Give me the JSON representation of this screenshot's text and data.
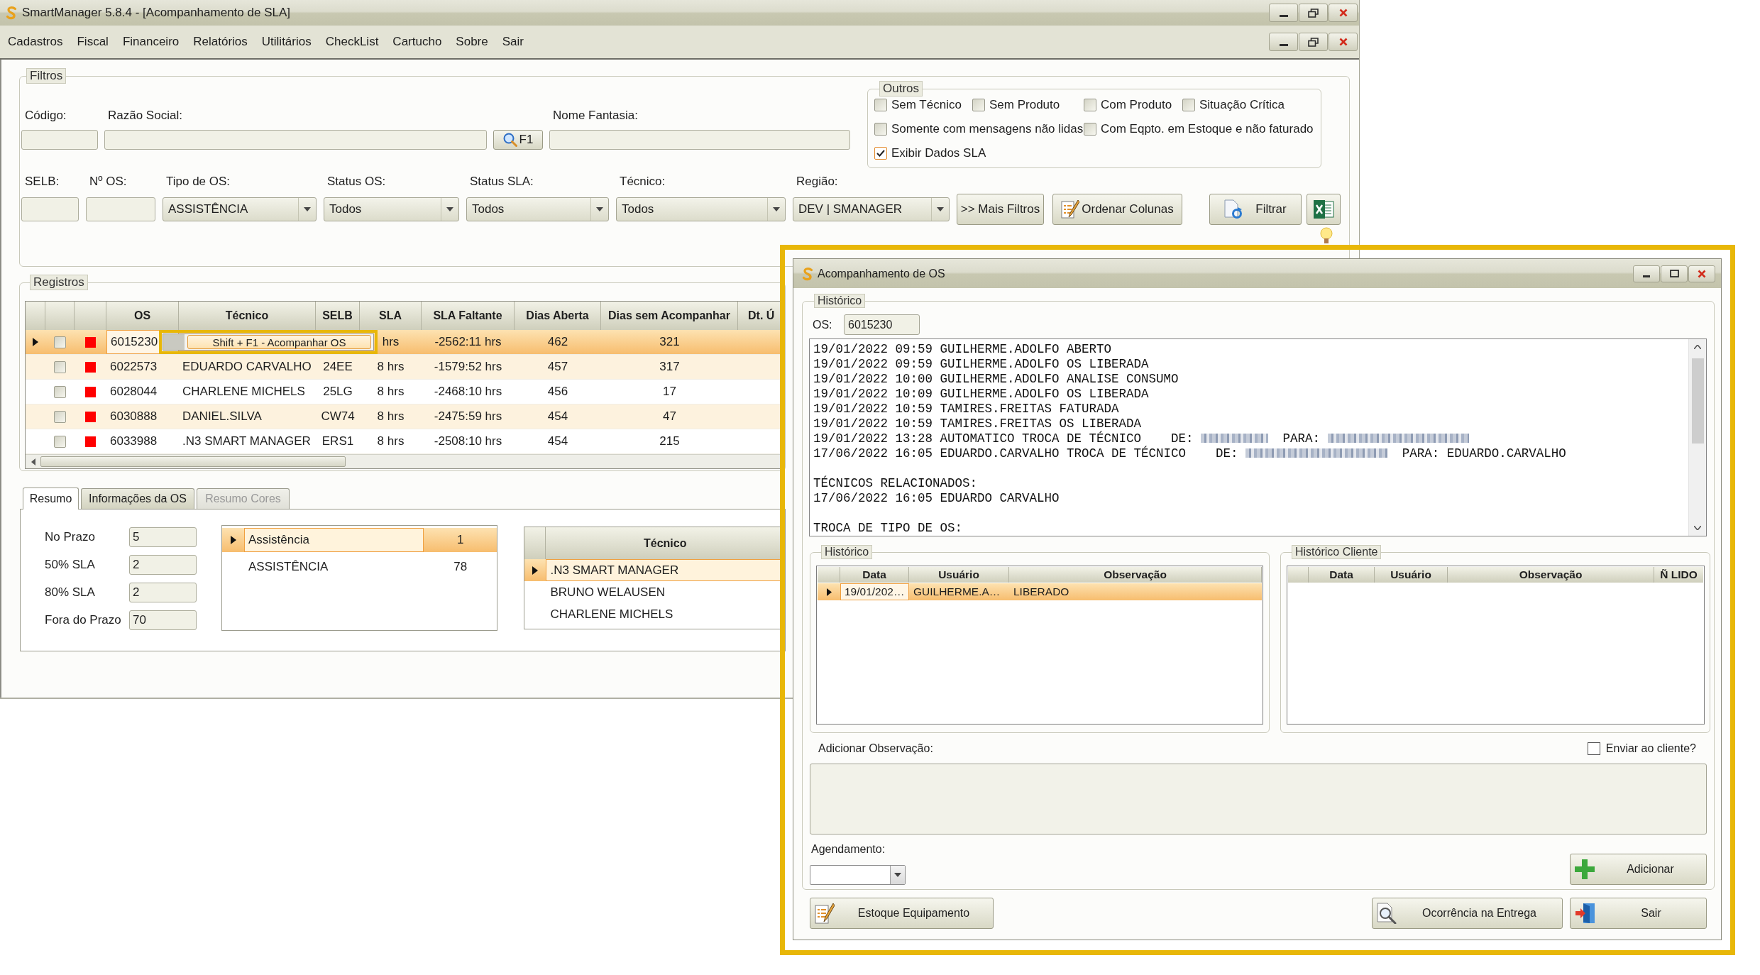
{
  "window": {
    "title": "SmartManager 5.8.4 - [Acompanhamento de SLA]"
  },
  "menu": [
    "Cadastros",
    "Fiscal",
    "Financeiro",
    "Relatórios",
    "Utilitários",
    "CheckList",
    "Cartucho",
    "Sobre",
    "Sair"
  ],
  "filters": {
    "title": "Filtros",
    "row1": [
      {
        "kind": "input",
        "label": "Código:"
      },
      {
        "kind": "input",
        "label": "Razão Social:"
      },
      {
        "kind": "search",
        "text": "F1"
      },
      {
        "kind": "input",
        "label": "Nome Fantasia:"
      }
    ],
    "others": {
      "title": "Outros",
      "options": [
        {
          "label": "Sem Técnico",
          "checked": false
        },
        {
          "label": "Sem Produto",
          "checked": false
        },
        {
          "label": "Com Produto",
          "checked": false
        },
        {
          "label": "Situação Crítica",
          "checked": false
        },
        {
          "label": "Somente com mensagens não lidas",
          "checked": false
        },
        {
          "label": "Com Eqpto. em Estoque e não faturado",
          "checked": false
        },
        {
          "label": "Exibir Dados SLA",
          "checked": true
        }
      ]
    },
    "row2": [
      {
        "kind": "input",
        "label": "SELB:"
      },
      {
        "kind": "input",
        "label": "Nº OS:"
      },
      {
        "kind": "combo",
        "label": "Tipo de OS:",
        "value": "ASSISTÊNCIA"
      },
      {
        "kind": "combo",
        "label": "Status OS:",
        "value": "Todos"
      },
      {
        "kind": "combo",
        "label": "Status SLA:",
        "value": "Todos"
      },
      {
        "kind": "combo",
        "label": "Técnico:",
        "value": "Todos"
      },
      {
        "kind": "combo",
        "label": "Região:",
        "value": "DEV | SMANAGER"
      }
    ],
    "actions": [
      {
        "kind": "more",
        "label": ">> Mais Filtros"
      },
      {
        "kind": "order",
        "label": "Ordenar Colunas"
      },
      {
        "kind": "filter",
        "label": "Filtrar"
      },
      {
        "kind": "export"
      }
    ]
  },
  "records": {
    "title": "Registros",
    "columns": [
      "OS",
      "Técnico",
      "SELB",
      "SLA",
      "SLA Faltante",
      "Dias Aberta",
      "Dias sem Acompanhar",
      "Dt. Ú"
    ],
    "rows": [
      {
        "selected": true,
        "checked": false,
        "color": "#ff0000",
        "os": "6015230",
        "sla": "hrs",
        "sla_remaining": "-2562:11 hrs",
        "days_open": "462",
        "days_without_follow_up": "321"
      },
      {
        "selected": false,
        "checked": false,
        "color": "#ff0000",
        "os": "6022573",
        "technician": "EDUARDO CARVALHO",
        "selb": "24EE",
        "sla": "8 hrs",
        "sla_remaining": "-1579:52 hrs",
        "days_open": "457",
        "days_without_follow_up": "317"
      },
      {
        "selected": false,
        "checked": false,
        "color": "#ff0000",
        "os": "6028044",
        "technician": "CHARLENE MICHELS",
        "selb": "25LG",
        "sla": "8 hrs",
        "sla_remaining": "-2468:10 hrs",
        "days_open": "456",
        "days_without_follow_up": "17"
      },
      {
        "selected": false,
        "checked": false,
        "color": "#ff0000",
        "os": "6030888",
        "technician": "DANIEL.SILVA",
        "selb": "CW74",
        "sla": "8 hrs",
        "sla_remaining": "-2475:59 hrs",
        "days_open": "454",
        "days_without_follow_up": "47"
      },
      {
        "selected": false,
        "checked": false,
        "color": "#ff0000",
        "os": "6033988",
        "technician": ".N3 SMART MANAGER",
        "selb": "ERS1",
        "sla": "8 hrs",
        "sla_remaining": "-2508:10 hrs",
        "days_open": "454",
        "days_without_follow_up": "215"
      }
    ],
    "context_menu": {
      "items": [
        {
          "label": "Shift + F1 - Acompanhar OS",
          "selected": true
        }
      ]
    }
  },
  "summary": {
    "tabs": [
      {
        "label": "Resumo",
        "selected": true,
        "disabled": false
      },
      {
        "label": "Informações da OS",
        "selected": false,
        "disabled": false
      },
      {
        "label": "Resumo Cores",
        "selected": false,
        "disabled": true
      }
    ],
    "counts": [
      {
        "label": "No Prazo",
        "value": "5"
      },
      {
        "label": "50% SLA",
        "value": "2"
      },
      {
        "label": "80% SLA",
        "value": "2"
      },
      {
        "label": "Fora do Prazo",
        "value": "70"
      }
    ],
    "types": [
      {
        "name": "Assistência",
        "count": "1",
        "selected": true
      },
      {
        "name": "ASSISTÊNCIA",
        "count": "78",
        "selected": false
      }
    ],
    "technicians": {
      "columns": [
        "Técnico"
      ],
      "rows": [
        {
          "name": ".N3 SMART MANAGER",
          "selected": true
        },
        {
          "name": "BRUNO WELAUSEN",
          "selected": false
        },
        {
          "name": "CHARLENE MICHELS",
          "selected": false
        }
      ]
    }
  },
  "dialog": {
    "title": "Acompanhamento de OS",
    "history": {
      "title": "Histórico",
      "os_label": "OS:",
      "os_value": "6015230",
      "log": [
        {
          "lines": [
            {
              "parts": [
                {
                  "kind": "text",
                  "text": "19/01/2022 09:59 GUILHERME.ADOLFO ABERTO"
                }
              ]
            },
            {
              "parts": [
                {
                  "kind": "text",
                  "text": "19/01/2022 09:59 GUILHERME.ADOLFO OS LIBERADA"
                }
              ]
            },
            {
              "parts": [
                {
                  "kind": "text",
                  "text": "19/01/2022 10:00 GUILHERME.ADOLFO ANALISE CONSUMO"
                }
              ]
            },
            {
              "parts": [
                {
                  "kind": "text",
                  "text": "19/01/2022 10:09 GUILHERME.ADOLFO OS LIBERADA"
                }
              ]
            },
            {
              "parts": [
                {
                  "kind": "text",
                  "text": "19/01/2022 10:59 TAMIRES.FREITAS FATURADA"
                }
              ]
            },
            {
              "parts": [
                {
                  "kind": "text",
                  "text": "19/01/2022 10:59 TAMIRES.FREITAS OS LIBERADA"
                }
              ]
            },
            {
              "parts": [
                {
                  "kind": "text",
                  "text": "19/01/2022 13:28 AUTOMATICO TROCA DE TÉCNICO    DE:"
                },
                {
                  "kind": "short_blur"
                },
                {
                  "kind": "text",
                  "text": "PARA:"
                },
                {
                  "kind": "long_blur"
                }
              ]
            },
            {
              "parts": [
                {
                  "kind": "text",
                  "text": "17/06/2022 16:05 EDUARDO.CARVALHO TROCA DE TÉCNICO    DE:"
                },
                {
                  "kind": "long_blur"
                },
                {
                  "kind": "text",
                  "text": "PARA: EDUARDO.CARVALHO"
                }
              ]
            }
          ]
        },
        {
          "lines": [
            {
              "parts": [
                {
                  "kind": "text",
                  "text": "TÉCNICOS RELACIONADOS:"
                }
              ]
            },
            {
              "parts": [
                {
                  "kind": "text",
                  "text": "17/06/2022 16:05 EDUARDO CARVALHO"
                }
              ]
            }
          ]
        },
        {
          "lines": [
            {
              "parts": [
                {
                  "kind": "text",
                  "text": "TROCA DE TIPO DE OS:"
                }
              ]
            }
          ]
        }
      ]
    },
    "history_grid": {
      "title": "Histórico",
      "columns": [
        "Data",
        "Usuário",
        "Observação"
      ],
      "rows": [
        {
          "selected": true,
          "cells": [
            "19/01/202…",
            "GUILHERME.A…",
            "LIBERADO"
          ]
        }
      ]
    },
    "client_grid": {
      "title": "Histórico Cliente",
      "columns": [
        "Data",
        "Usuário",
        "Observação",
        "Ñ LIDO"
      ]
    },
    "observation": {
      "label": "Adicionar Observação:"
    },
    "send_to_client": {
      "label": "Enviar ao cliente?",
      "checked": false
    },
    "schedule": {
      "label": "Agendamento:"
    },
    "add_button": {
      "label": "Adicionar"
    },
    "buttons": [
      {
        "kind": "stock",
        "label": "Estoque Equipamento"
      },
      {
        "kind": "occurrence",
        "label": "Ocorrência na Entrega"
      },
      {
        "kind": "exit",
        "label": "Sair"
      }
    ]
  }
}
